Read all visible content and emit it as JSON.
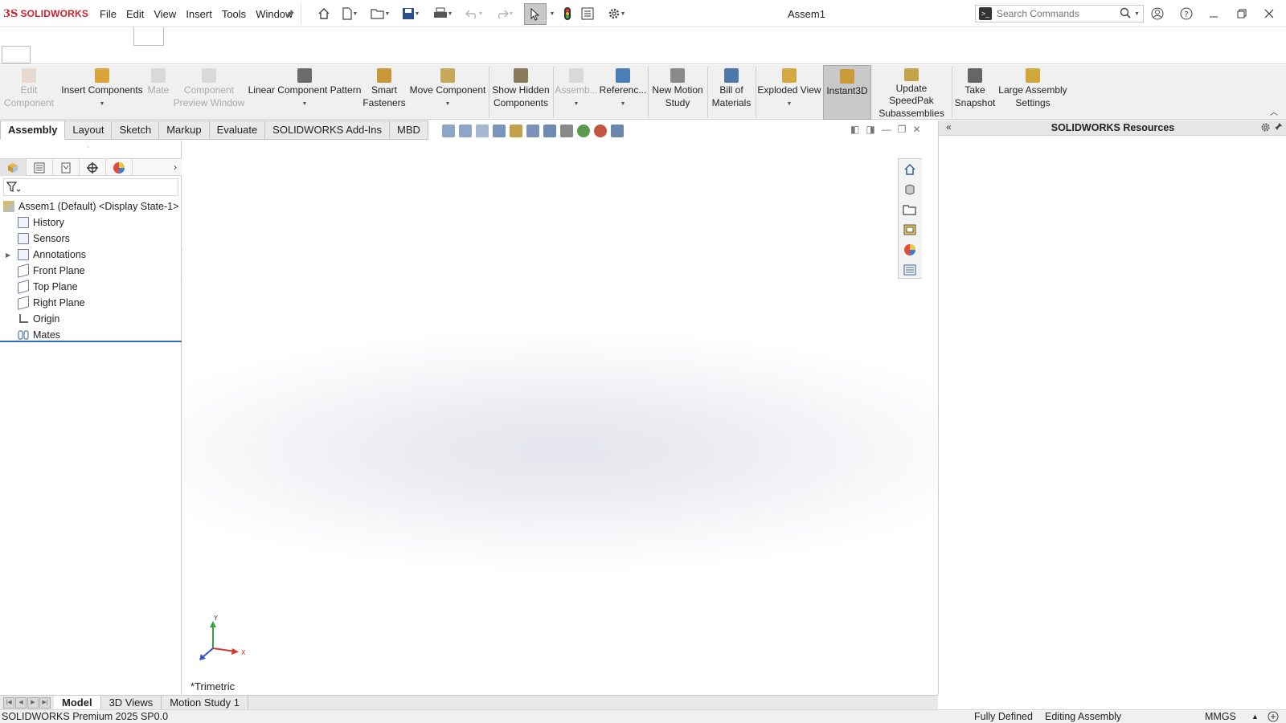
{
  "app": {
    "brand_mark": "3S",
    "brand_word": "SOLIDWORKS",
    "document_title": "Assem1"
  },
  "menus": [
    "File",
    "Edit",
    "View",
    "Insert",
    "Tools",
    "Window"
  ],
  "search": {
    "placeholder": "Search Commands"
  },
  "ribbon": {
    "buttons": [
      {
        "label1": "Edit",
        "label2": "Component",
        "state": "disabled",
        "icon_color": "#d8b29b"
      },
      {
        "label1": "Insert Components",
        "label2": "",
        "state": "normal",
        "dropdown": true,
        "icon_color": "#d9a43a"
      },
      {
        "label1": "Mate",
        "label2": "",
        "state": "disabled",
        "icon_color": "#b0b0b0"
      },
      {
        "label1": "Component",
        "label2": "Preview Window",
        "state": "disabled",
        "icon_color": "#b0b0b0"
      },
      {
        "label1": "Linear Component Pattern",
        "label2": "",
        "state": "normal",
        "dropdown": true,
        "icon_color": "#6c6c6c"
      },
      {
        "label1": "Smart",
        "label2": "Fasteners",
        "state": "normal",
        "icon_color": "#c9963a"
      },
      {
        "label1": "Move Component",
        "label2": "",
        "state": "normal",
        "dropdown": true,
        "icon_color": "#c8a85a"
      },
      {
        "label1": "Show Hidden",
        "label2": "Components",
        "state": "normal",
        "icon_color": "#8b7a5a"
      },
      {
        "label1": "Assemb...",
        "label2": "",
        "state": "disabled",
        "dropdown": true,
        "icon_color": "#b0b0b0"
      },
      {
        "label1": "Referenc...",
        "label2": "",
        "state": "normal",
        "dropdown": true,
        "icon_color": "#4a7fb5"
      },
      {
        "label1": "New Motion",
        "label2": "Study",
        "state": "normal",
        "icon_color": "#8a8a8a"
      },
      {
        "label1": "Bill of",
        "label2": "Materials",
        "state": "normal",
        "icon_color": "#4d79a8"
      },
      {
        "label1": "Exploded View",
        "label2": "",
        "state": "normal",
        "dropdown": true,
        "icon_color": "#d4a940"
      },
      {
        "label1": "Instant3D",
        "label2": "",
        "state": "active",
        "icon_color": "#c89a38"
      },
      {
        "label1": "Update SpeedPak",
        "label2": "Subassemblies",
        "state": "normal",
        "icon_color": "#c5a348"
      },
      {
        "label1": "Take",
        "label2": "Snapshot",
        "state": "normal",
        "icon_color": "#666666"
      },
      {
        "label1": "Large Assembly",
        "label2": "Settings",
        "state": "normal",
        "icon_color": "#d1a83c"
      }
    ]
  },
  "command_tabs": [
    "Assembly",
    "Layout",
    "Sketch",
    "Markup",
    "Evaluate",
    "SOLIDWORKS Add-Ins",
    "MBD"
  ],
  "tree": {
    "root": "Assem1 (Default) <Display State-1>",
    "items": [
      "History",
      "Sensors",
      "Annotations",
      "Front Plane",
      "Top Plane",
      "Right Plane",
      "Origin",
      "Mates"
    ]
  },
  "viewport": {
    "view_name": "*Trimetric",
    "axis_x": "X",
    "axis_y": "Y"
  },
  "right_panel": {
    "title": "SOLIDWORKS Resources"
  },
  "bottom_tabs": [
    "Model",
    "3D Views",
    "Motion Study 1"
  ],
  "status": {
    "product": "SOLIDWORKS Premium 2025 SP0.0",
    "definition": "Fully Defined",
    "mode": "Editing Assembly",
    "units": "MMGS"
  },
  "colors": {
    "brand": "#d0202a",
    "accent": "#2f6fbf"
  }
}
